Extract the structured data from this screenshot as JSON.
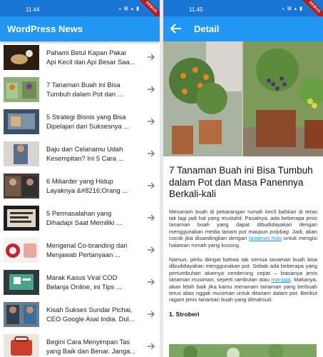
{
  "status": {
    "left_time": "11.44",
    "right_time": "11.45",
    "icons": "⁎ ⊠ ▴ ▮",
    "debug": "DEBUG"
  },
  "list_screen": {
    "app_title": "WordPress News",
    "items": [
      {
        "line1": "Pahami Betul Kapan Pakai",
        "line2": "Api Kecil dan Api Besar Saa..."
      },
      {
        "line1": "7 Tanaman Buah ini Bisa",
        "line2": "Tumbuh dalam Pot dan ..."
      },
      {
        "line1": "5 Strategi Bisnis yang Bisa",
        "line2": "Dipelajari dari Suksesnya ..."
      },
      {
        "line1": "Baju dan Celanamu Udah",
        "line2": "Kesempitan? Ini 5 Cara ..."
      },
      {
        "line1": "6 Miliarder yang Hidup",
        "line2": "Layaknya &#8216;Orang ..."
      },
      {
        "line1": "5 Permasalahan yang",
        "line2": "Dihadapi Saat Memiliki ..."
      },
      {
        "line1": "Mengenal Co-branding dan",
        "line2": "Menjawab Pertanyaan ..."
      },
      {
        "line1": "Marak Kasus Viral COD",
        "line2": "Belanja Online, ini Tips ..."
      },
      {
        "line1": "Kisah Sukses Sundar Pichai,",
        "line2": "CEO Google Asal India. Dul..."
      },
      {
        "line1": "Begini Cara Menyimpan Tas",
        "line2": "yang Baik dan Benar. Janga..."
      }
    ]
  },
  "detail_screen": {
    "app_title": "Detail",
    "article_title": "7 Tanaman Buah ini Bisa Tumbuh dalam Pot dan Masa Panennya Berkali-kali",
    "para1": {
      "a": "Menanam buah di pekarangan rumah kecil bahkan di teras tak lagi jadi hal yang mustahil. Pasalnya, ada beberapa jenis tanaman buah yang dapat dibudidayakan dengan menggunakan media tanam pot maupun ",
      "italic": "polybag",
      "b": ". Jadi, akan cocok jika disandingkan dengan ",
      "link": "tanaman hias",
      "c": " untuk mengisi halaman rumah yang kosong."
    },
    "para2": {
      "a": "Namun, perlu diingat bahwa tak semua tanaman buah bisa dibudidayakan menggunakan pot. Sebab ada beberapa yang pertumbuhan akarnya cenderung cepat – biasanya jenis tanaman musiman, seperti rambutan atau ",
      "link": "mangga",
      "b": ". Makanya, akan lebih baik jika kamu menanam tanaman yang berbuah terus alias nggak musiman untuk ditanam dalam pot. Berikut ragam jenis tanaman buah yang dimaksud."
    },
    "subheading": "1. Stroberi"
  },
  "colors": {
    "statusbar": "#1976d2",
    "appbar": "#2196f3",
    "link": "#2196f3"
  },
  "icons": {
    "back": "arrow-back-icon",
    "forward": "arrow-forward-icon"
  }
}
